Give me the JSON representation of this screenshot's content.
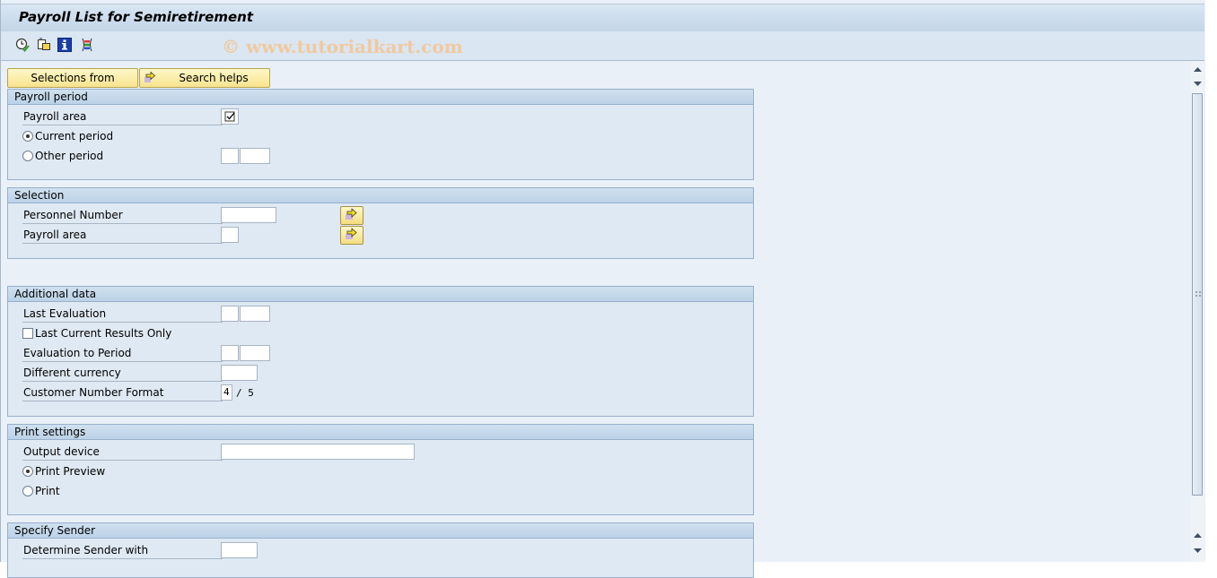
{
  "window": {
    "title": "Payroll List for Semiretirement",
    "watermark": "© www.tutorialkart.com"
  },
  "toolbar": {
    "icons": [
      {
        "name": "execute-clock-icon",
        "tooltip": "Execute"
      },
      {
        "name": "get-variant-icon",
        "tooltip": "Get Variant"
      },
      {
        "name": "information-icon",
        "tooltip": "Program Documentation"
      },
      {
        "name": "selection-options-icon",
        "tooltip": "Selection Options"
      }
    ]
  },
  "buttons": {
    "selections_from": "Selections from",
    "search_helps": "Search helps"
  },
  "groups": {
    "payroll_period": {
      "title": "Payroll period",
      "payroll_area_label": "Payroll area",
      "payroll_area_checked": true,
      "current_period_label": "Current period",
      "current_period_selected": true,
      "other_period_label": "Other period",
      "other_period_selected": false,
      "other_period_value1": "",
      "other_period_value2": ""
    },
    "selection": {
      "title": "Selection",
      "personnel_number_label": "Personnel Number",
      "personnel_number_value": "",
      "payroll_area_label": "Payroll area",
      "payroll_area_value": ""
    },
    "additional_data": {
      "title": "Additional data",
      "last_evaluation_label": "Last Evaluation",
      "last_evaluation_value1": "",
      "last_evaluation_value2": "",
      "last_current_results_label": "Last Current Results Only",
      "last_current_results_checked": false,
      "evaluation_to_period_label": "Evaluation to Period",
      "evaluation_to_period_value1": "",
      "evaluation_to_period_value2": "",
      "different_currency_label": "Different currency",
      "different_currency_value": "",
      "customer_number_format_label": "Customer Number Format",
      "customer_number_format_value": "4",
      "customer_number_format_suffix": "/ 5"
    },
    "print_settings": {
      "title": "Print settings",
      "output_device_label": "Output device",
      "output_device_value": "",
      "print_preview_label": "Print Preview",
      "print_preview_selected": true,
      "print_label": "Print",
      "print_selected": false
    },
    "specify_sender": {
      "title": "Specify Sender",
      "determine_sender_label": "Determine Sender with",
      "determine_sender_value": ""
    }
  }
}
